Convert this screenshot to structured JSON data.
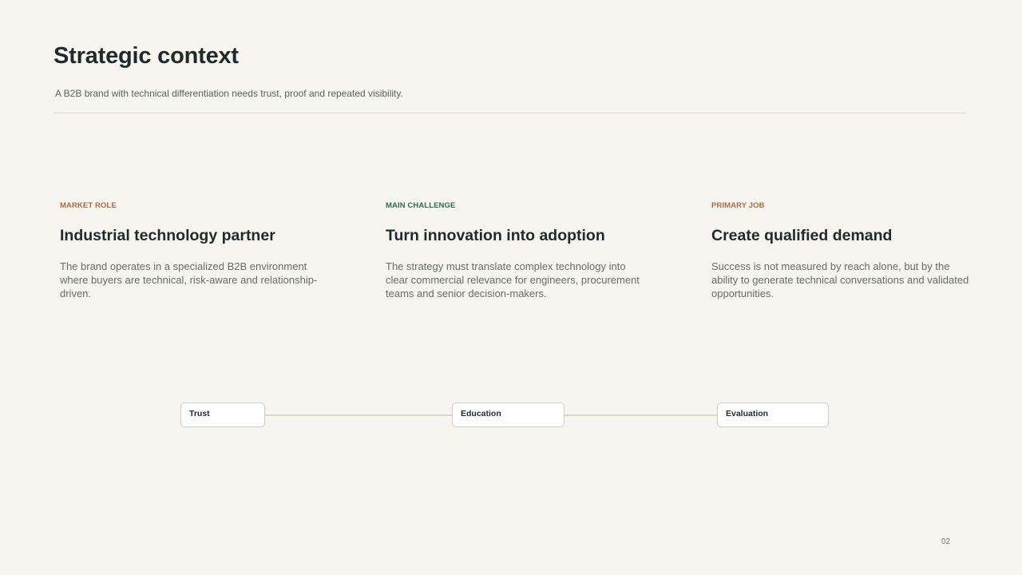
{
  "slide": {
    "title": "Strategic context",
    "subtitle": "A B2B brand with technical differentiation needs trust, proof and repeated visibility.",
    "page_number": "02"
  },
  "columns": [
    {
      "label": "MARKET ROLE",
      "label_color": "#b06a43",
      "heading": "Industrial technology partner",
      "body": "The brand operates in a specialized B2B environment where buyers are technical, risk-aware and relationship-driven."
    },
    {
      "label": "MAIN CHALLENGE",
      "label_color": "#2f6b55",
      "heading": "Turn innovation into adoption",
      "body": "The strategy must translate complex technology into clear commercial relevance for engineers, procurement teams and senior decision-makers."
    },
    {
      "label": "PRIMARY JOB",
      "label_color": "#b06a43",
      "heading": "Create qualified demand",
      "body": "Success is not measured by reach alone, but by the ability to generate technical conversations and validated opportunities."
    }
  ],
  "journey": {
    "stages": [
      "Trust",
      "Education",
      "Evaluation"
    ]
  }
}
